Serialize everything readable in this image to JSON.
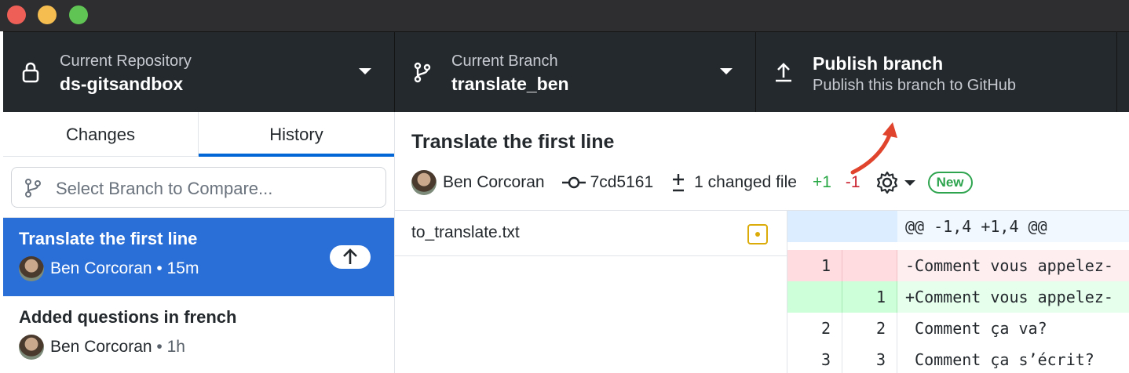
{
  "toolbar": {
    "repository": {
      "label": "Current Repository",
      "value": "ds-gitsandbox"
    },
    "branch": {
      "label": "Current Branch",
      "value": "translate_ben"
    },
    "publish": {
      "title": "Publish branch",
      "subtitle": "Publish this branch to GitHub"
    }
  },
  "sidebar": {
    "tabs": [
      {
        "label": "Changes"
      },
      {
        "label": "History",
        "active": true
      }
    ],
    "compare_placeholder": "Select Branch to Compare...",
    "commits": [
      {
        "title": "Translate the first line",
        "author": "Ben Corcoran",
        "time": "15m",
        "selected": true
      },
      {
        "title": "Added questions in french",
        "author": "Ben Corcoran",
        "time": "1h",
        "selected": false
      }
    ]
  },
  "commit_detail": {
    "title": "Translate the first line",
    "author": "Ben Corcoran",
    "sha": "7cd5161",
    "changed_files": "1 changed file",
    "additions": "+1",
    "deletions": "-1",
    "badge": "New"
  },
  "files": [
    {
      "name": "to_translate.txt",
      "status": "modified"
    }
  ],
  "diff": {
    "hunk": "@@ -1,4 +1,4 @@",
    "lines": [
      {
        "type": "del",
        "old": "1",
        "new": "",
        "text": "-Comment vous appelez-"
      },
      {
        "type": "add",
        "old": "",
        "new": "1",
        "text": "+Comment vous appelez-"
      },
      {
        "type": "ctx",
        "old": "2",
        "new": "2",
        "text": " Comment ça va?"
      },
      {
        "type": "ctx",
        "old": "3",
        "new": "3",
        "text": " Comment ça s’écrit?"
      }
    ]
  },
  "colors": {
    "accent": "#2a6fd7",
    "toolbar": "#24292e",
    "annotation_arrow": "#e0442c"
  }
}
